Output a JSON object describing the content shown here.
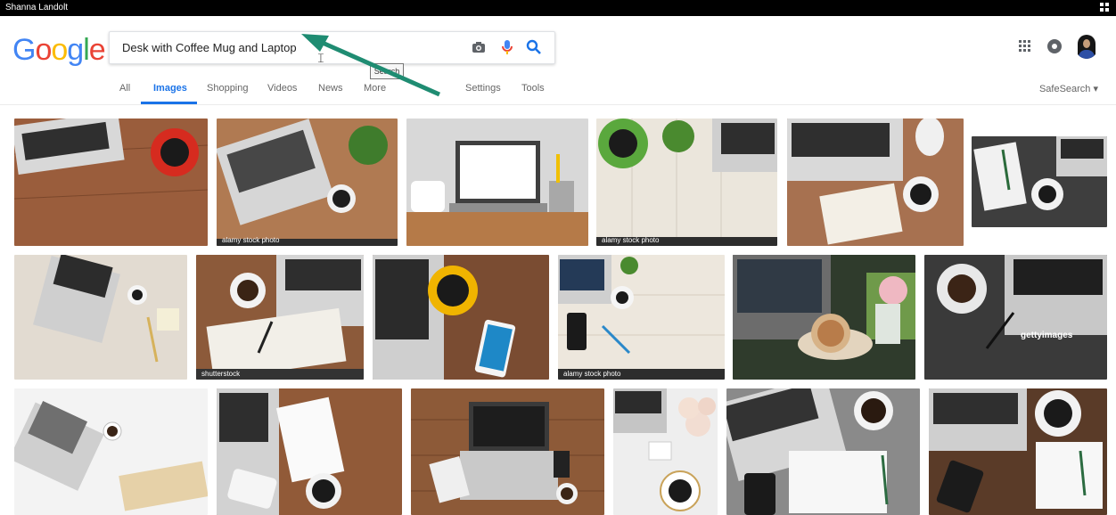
{
  "window": {
    "user_name": "Shanna Landolt"
  },
  "brand": {
    "logo_letters": [
      "G",
      "o",
      "o",
      "g",
      "l",
      "e"
    ],
    "logo_colors": [
      "#4285F4",
      "#EA4335",
      "#FBBC05",
      "#4285F4",
      "#34A853",
      "#EA4335"
    ]
  },
  "search": {
    "query": "Desk with Coffee Mug and Laptop",
    "tooltip": "Search",
    "icons": [
      "camera-icon",
      "microphone-icon",
      "search-icon"
    ]
  },
  "tabs": {
    "items": [
      "All",
      "Images",
      "Shopping",
      "Videos",
      "News",
      "More",
      "Settings",
      "Tools"
    ],
    "active": "Images",
    "safesearch": "SafeSearch ▾"
  },
  "header_icons": [
    "apps-icon",
    "notifications-icon",
    "avatar"
  ],
  "results": {
    "watermarks": [
      "alamy stock photo",
      "alamy stock photo",
      "shutterstock",
      "gettyimages",
      "alamy stock photo"
    ],
    "image_topics": [
      "laptop and red coffee cup on wood",
      "laptop, plant and coffee on desk",
      "laptop, white mug and pencil cup",
      "green coffee cup, plant and laptop",
      "laptop, calendar and coffee",
      "notebook, coffee and laptop on dark desk",
      "laptop and coffee on light desk",
      "coffee cup, notebook and laptop",
      "yellow coffee cup, phone and laptop",
      "laptop, phone and coffee",
      "laptop with coffee and flowers",
      "coffee, pen and laptop",
      "laptop and book on white desk",
      "notebook, phone and coffee",
      "laptop on wooden desk",
      "coffee cup with roses",
      "laptop, notebook and coffee",
      "laptop, phone and notebook"
    ],
    "accent_colors": {
      "wood": "#8a5a3a",
      "dark": "#3d3d3d",
      "light": "#e9e4dc",
      "red": "#d62b1f",
      "yellow": "#f0b400",
      "green": "#59a93f"
    }
  }
}
